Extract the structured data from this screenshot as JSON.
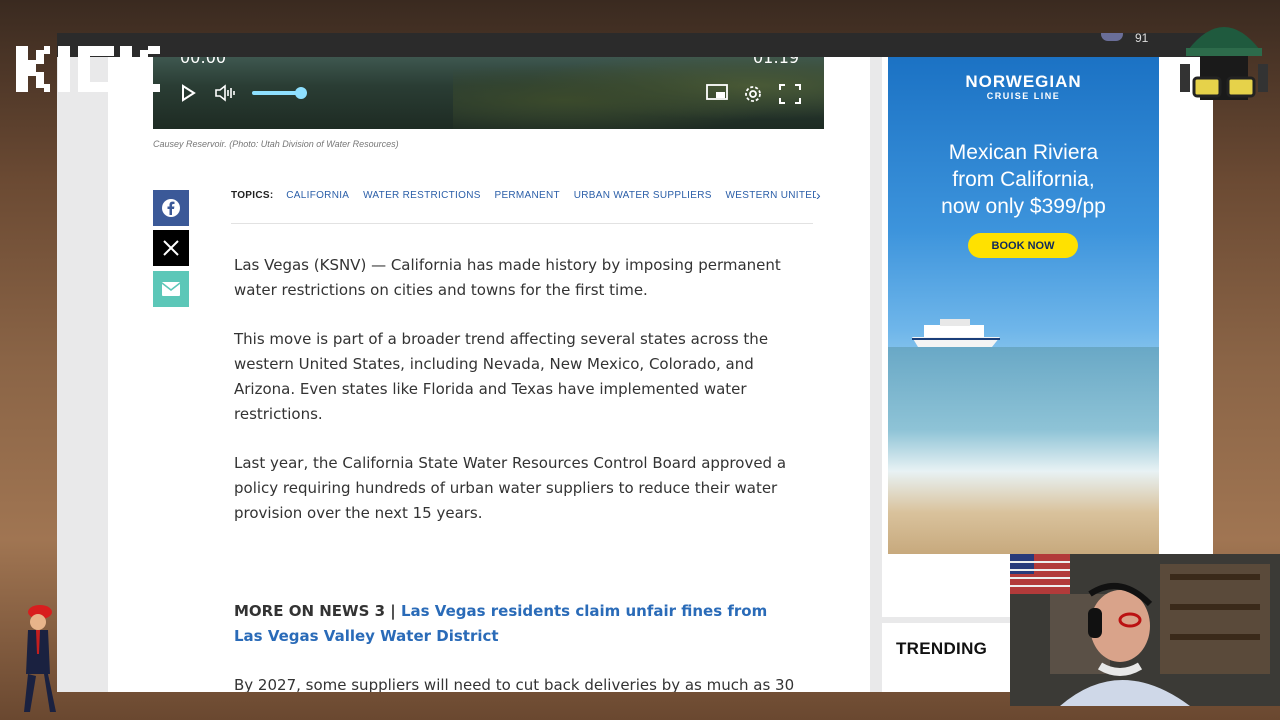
{
  "video": {
    "current_time": "00:00",
    "duration": "01:19",
    "volume_fraction": 0.85,
    "caption": "Causey Reservoir. (Photo: Utah Division of Water Resources)"
  },
  "browser": {
    "badge_count": "91"
  },
  "topics": {
    "label": "TOPICS:",
    "items": [
      "CALIFORNIA",
      "WATER RESTRICTIONS",
      "PERMANENT",
      "URBAN WATER SUPPLIERS",
      "WESTERN UNITED STAT"
    ]
  },
  "article": {
    "p1": "Las Vegas (KSNV) — California has made history by imposing permanent water restrictions on cities and towns for the first time.",
    "p2": "This move is part of a broader trend affecting several states across the western United States, including Nevada, New Mexico, Colorado, and Arizona. Even states like Florida and Texas have implemented water restrictions.",
    "p3": "Last year, the California State Water Resources Control Board approved a policy requiring hundreds of urban water suppliers to reduce their water provision over the next 15 years.",
    "more_prefix": "MORE ON NEWS 3 | ",
    "more_link": "Las Vegas residents claim unfair fines from Las Vegas Valley Water District",
    "p4": "By 2027, some suppliers will need to cut back deliveries by as much as 30"
  },
  "ad": {
    "brand_line1": "NORWEGIAN",
    "brand_line2": "CRUISE LINE",
    "offer_line1": "Mexican Riviera",
    "offer_line2": "from California,",
    "offer_line3": "now only $399/pp",
    "button": "BOOK NOW"
  },
  "sidebar": {
    "trending_title": "TRENDING"
  },
  "overlay": {
    "logo_text": "KICK"
  },
  "colors": {
    "link": "#2a6bb8",
    "topic": "#2a5ea8",
    "facebook": "#3b5998",
    "x": "#000000",
    "email": "#5cc7b8",
    "ad_button": "#ffe100"
  }
}
